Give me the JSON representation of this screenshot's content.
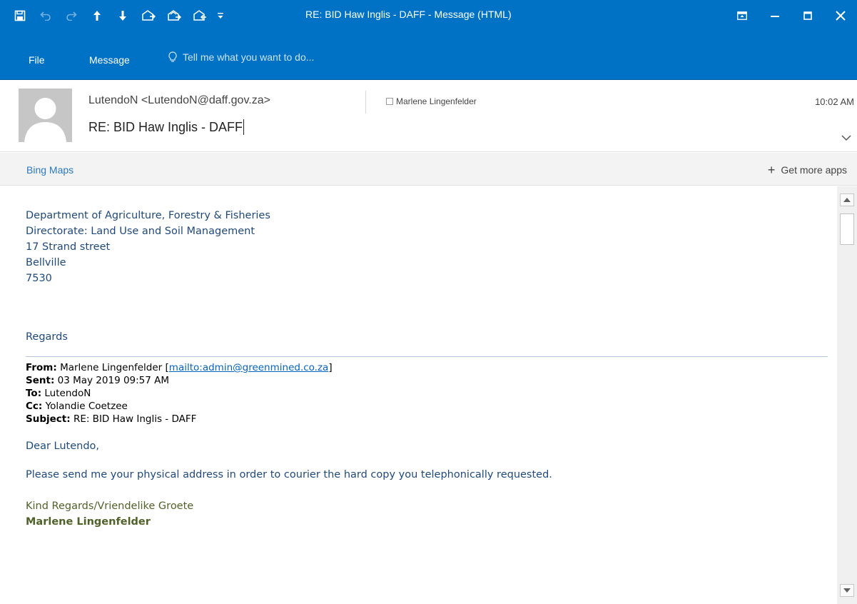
{
  "window": {
    "title": "RE: BID Haw Inglis - DAFF - Message (HTML)"
  },
  "quick_access": {
    "icons": [
      "save-icon",
      "undo-icon",
      "redo-icon",
      "previous-item-icon",
      "next-item-icon",
      "reply-icon",
      "reply-all-icon",
      "forward-icon",
      "customize-toolbar-icon"
    ]
  },
  "ribbon": {
    "tabs": [
      "File",
      "Message"
    ],
    "tell_me": "Tell me what you want to do..."
  },
  "header": {
    "sender": "LutendoN <LutendoN@daff.gov.za>",
    "recipient": "Marlene Lingenfelder",
    "time": "10:02 AM",
    "subject": "RE: BID Haw Inglis - DAFF"
  },
  "apps_bar": {
    "bing_maps": "Bing Maps",
    "get_more_apps": "Get more apps"
  },
  "body": {
    "address": [
      "Department of Agriculture, Forestry & Fisheries",
      "Directorate: Land Use and Soil Management",
      "17 Strand street",
      "Bellville",
      "7530"
    ],
    "regards": "Regards",
    "quoted": {
      "from_label": "From:",
      "from_name": "Marlene Lingenfelder [",
      "from_link": "mailto:admin@greenmined.co.za",
      "from_close": "]",
      "sent_label": "Sent:",
      "sent_value": "03 May 2019 09:57 AM",
      "to_label": "To:",
      "to_value": "LutendoN",
      "cc_label": "Cc:",
      "cc_value": "Yolandie Coetzee",
      "subject_label": "Subject:",
      "subject_value": "RE: BID Haw Inglis - DAFF"
    },
    "greeting": "Dear Lutendo,",
    "message": "Please send me your physical address in order to courier the hard copy you telephonically requested.",
    "closing": "Kind Regards/Vriendelike Groete",
    "signature_name": "Marlene Lingenfelder"
  },
  "colors": {
    "titlebar": "#0072c6",
    "body_blue": "#1f497d",
    "signature_green": "#4f6228",
    "link": "#0563c1"
  }
}
